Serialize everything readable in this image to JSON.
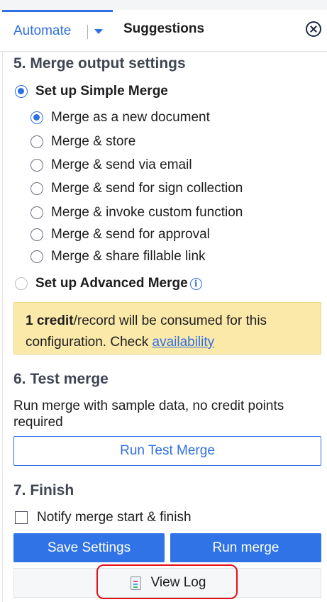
{
  "tabs": {
    "automate_label": "Automate",
    "suggestions_label": "Suggestions"
  },
  "section5": {
    "title": "5. Merge output settings",
    "simple_merge_label": "Set up Simple Merge",
    "simple_merge_selected": true,
    "options": [
      {
        "label": "Merge as a new document",
        "selected": true
      },
      {
        "label": "Merge & store",
        "selected": false
      },
      {
        "label": "Merge & send via email",
        "selected": false
      },
      {
        "label": "Merge & send for sign collection",
        "selected": false
      },
      {
        "label": "Merge & invoke custom function",
        "selected": false
      },
      {
        "label": "Merge & send for approval",
        "selected": false
      },
      {
        "label": "Merge & share fillable link",
        "selected": false
      }
    ],
    "advanced_merge_label": "Set up Advanced Merge",
    "info_glyph": "i",
    "notice": {
      "credit_bold": "1 credit",
      "text": "/record will be consumed for this configuration. Check ",
      "link": "availability"
    }
  },
  "section6": {
    "title": "6. Test merge",
    "description": "Run merge with sample data, no credit points required",
    "test_button": "Run Test Merge"
  },
  "section7": {
    "title": "7. Finish",
    "notify_label": "Notify merge start & finish",
    "notify_checked": false,
    "save_button": "Save Settings",
    "run_button": "Run merge",
    "view_log_button": "View Log"
  },
  "colors": {
    "accent": "#2f6fe4",
    "notice_bg": "#fbe9aa",
    "highlight": "#e0101a"
  },
  "icons": [
    "chevron-down-icon",
    "close-icon",
    "info-icon",
    "log-icon"
  ]
}
